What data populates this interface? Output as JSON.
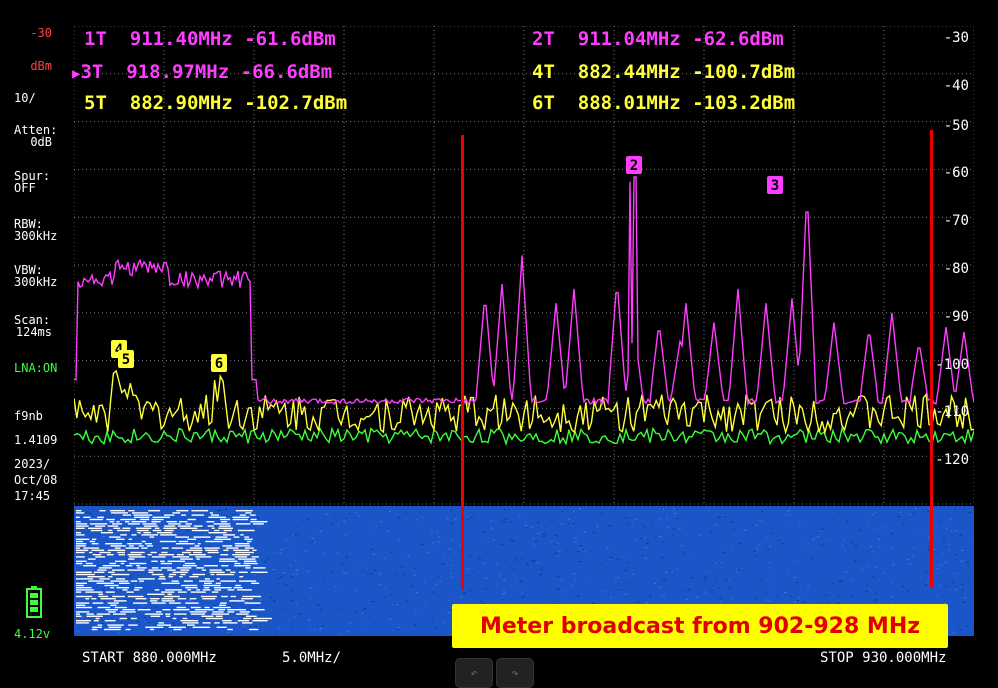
{
  "side": {
    "ref_level": "-30",
    "ref_unit": "dBm",
    "scale": "10/",
    "atten_label": "Atten:",
    "atten_value": "0dB",
    "spur_label": "Spur:",
    "spur_value": "OFF",
    "rbw_label": "RBW:",
    "rbw_value": "300kHz",
    "vbw_label": "VBW:",
    "vbw_value": "300kHz",
    "scan_label": "Scan:",
    "scan_value": "124ms",
    "lna": "LNA:ON",
    "firmware": "f9nb",
    "version": "1.4109",
    "date_year": "2023/",
    "date_md": "Oct/08",
    "time": "17:45",
    "battery_voltage": "4.12v"
  },
  "markers": [
    {
      "id": "1T",
      "freq": "911.40MHz",
      "level": "-61.6dBm"
    },
    {
      "id": "2T",
      "freq": "911.04MHz",
      "level": "-62.6dBm"
    },
    {
      "id": "3T",
      "freq": "918.97MHz",
      "level": "-66.6dBm"
    },
    {
      "id": "4T",
      "freq": "882.44MHz",
      "level": "-100.7dBm"
    },
    {
      "id": "5T",
      "freq": "882.90MHz",
      "level": "-102.7dBm"
    },
    {
      "id": "6T",
      "freq": "888.01MHz",
      "level": "-103.2dBm"
    }
  ],
  "active_marker_indicator": "▶",
  "y_axis_labels": [
    "-30",
    "-40",
    "-50",
    "-60",
    "-70",
    "-80",
    "-90",
    "-100",
    "-110",
    "-120"
  ],
  "trace_markers": {
    "m2": "2",
    "m3": "3",
    "m4": "4",
    "m5": "5",
    "m6": "6"
  },
  "bottom": {
    "start": "START 880.000MHz",
    "span": "5.0MHz/",
    "stop": "STOP 930.000MHz"
  },
  "annotation": "Meter broadcast from 902-928 MHz",
  "nav": {
    "prev": "↶",
    "next": "↷"
  },
  "colors": {
    "trace_max": "#ff3cff",
    "trace_actual": "#ffff3c",
    "trace_min": "#3cff3c",
    "waterfall": "#1a56c8",
    "annotation_bg": "#ffff00",
    "annotation_text": "#e00000"
  }
}
